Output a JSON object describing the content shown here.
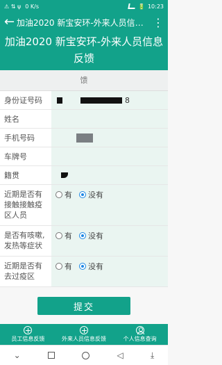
{
  "status": {
    "left_text": "⚠ ⇅ ψ",
    "speed": "0 K/s",
    "battery": "🔋",
    "time": "10:23"
  },
  "appbar": {
    "back": "←",
    "title": "加油2020 新宝安环-外来人员信息...",
    "more": "⋮"
  },
  "banner": {
    "title": "加油2020 新宝安环-外来人员信息反馈"
  },
  "subheader": {
    "text": "馈"
  },
  "form": {
    "id_label": "身份证号码",
    "id_suffix": "8",
    "name_label": "姓名",
    "phone_label": "手机号码",
    "plate_label": "车牌号",
    "origin_label": "籍贯",
    "q1_label": "近期是否有接触接触疫区人员",
    "q2_label": "是否有咳嗽,发热等症状",
    "q3_label": "近期是否有去过疫区",
    "opt_yes": "有",
    "opt_no": "没有"
  },
  "submit": {
    "label": "提交"
  },
  "tabs": [
    {
      "label": "员工信息反馈",
      "icon": "plus-icon"
    },
    {
      "label": "外来人员信息反馈",
      "icon": "plus-icon"
    },
    {
      "label": "个人信息查询",
      "icon": "person-icon"
    }
  ],
  "sysnav": {
    "down": "⌄",
    "square": "",
    "circle": "",
    "back": "◁",
    "extra": "⤓"
  },
  "colors": {
    "primary": "#12a28a",
    "radio_selected": "#1e88e5"
  }
}
